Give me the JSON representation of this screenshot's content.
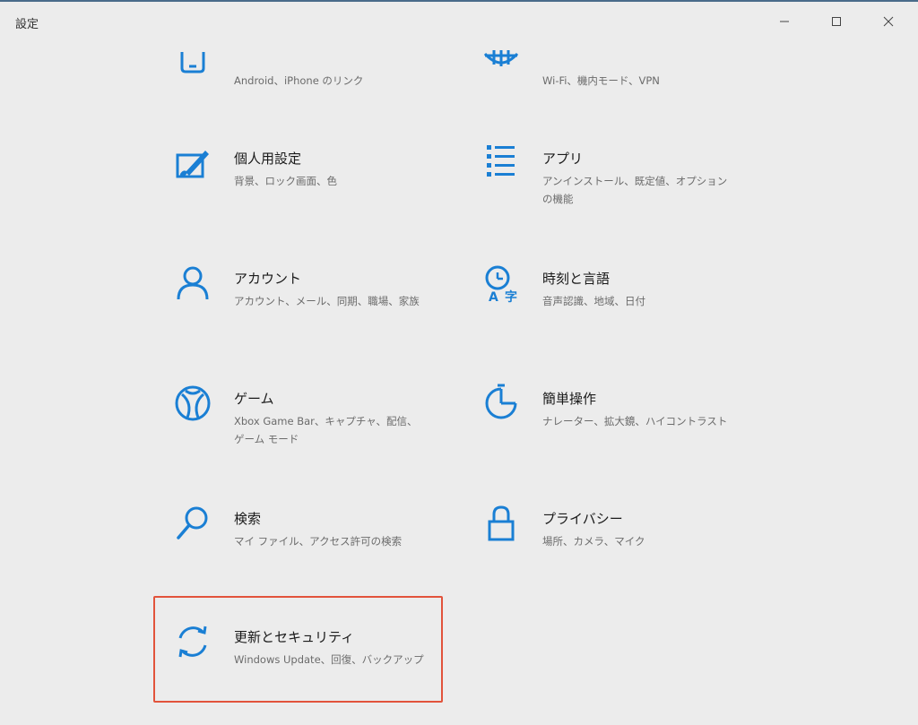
{
  "window": {
    "title": "設定"
  },
  "tiles": {
    "phone": {
      "name": "",
      "desc": "Android、iPhone のリンク",
      "icon": "phone-icon"
    },
    "network": {
      "name": "",
      "desc": "Wi-Fi、機内モード、VPN",
      "icon": "globe-icon"
    },
    "personalization": {
      "name": "個人用設定",
      "desc": "背景、ロック画面、色",
      "icon": "paint-icon"
    },
    "apps": {
      "name": "アプリ",
      "desc": "アンインストール、既定値、オプションの機能",
      "icon": "apps-list-icon"
    },
    "accounts": {
      "name": "アカウント",
      "desc": "アカウント、メール、同期、職場、家族",
      "icon": "person-icon"
    },
    "time_language": {
      "name": "時刻と言語",
      "desc": "音声認識、地域、日付",
      "icon": "time-language-icon"
    },
    "gaming": {
      "name": "ゲーム",
      "desc": "Xbox Game Bar、キャプチャ、配信、ゲーム モード",
      "icon": "xbox-icon"
    },
    "ease_of_access": {
      "name": "簡単操作",
      "desc": "ナレーター、拡大鏡、ハイコントラスト",
      "icon": "ease-of-access-icon"
    },
    "search": {
      "name": "検索",
      "desc": "マイ ファイル、アクセス許可の検索",
      "icon": "search-icon"
    },
    "privacy": {
      "name": "プライバシー",
      "desc": "場所、カメラ、マイク",
      "icon": "lock-icon"
    },
    "update_security": {
      "name": "更新とセキュリティ",
      "desc": "Windows Update、回復、バックアップ",
      "icon": "sync-icon"
    }
  },
  "colors": {
    "accent": "#1a7fd4",
    "highlight": "#e2533b",
    "background": "#ececec"
  }
}
